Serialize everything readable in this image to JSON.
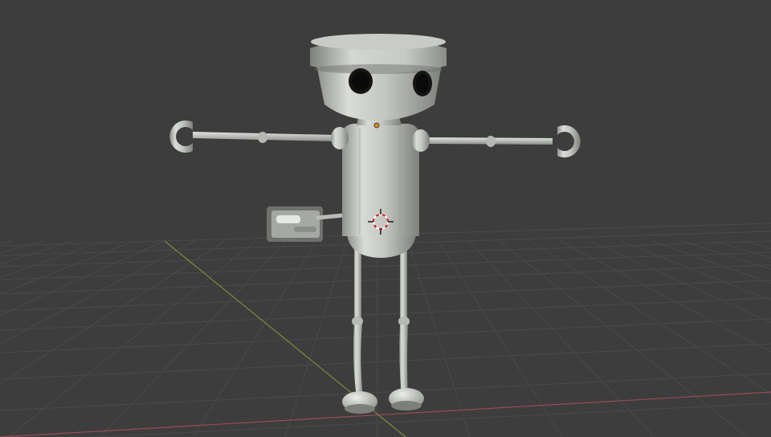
{
  "viewport": {
    "background": "#3d3d3d",
    "grid_color": "#4a4a4a",
    "x_axis_color": "#9a4b57",
    "y_axis_color": "#7e8a3b"
  },
  "scene": {
    "object": "robot-model",
    "material_tint": "#c9ccc6",
    "origin_marker_color": "#e28a1c",
    "cursor_ring_colors": [
      "#d02020",
      "#ffffff"
    ]
  }
}
